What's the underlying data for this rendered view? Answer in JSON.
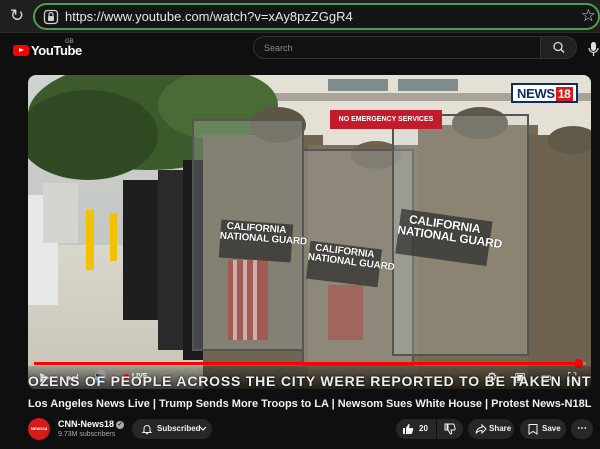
{
  "browser": {
    "url": "https://www.youtube.com/watch?v=xAy8pzZGgR4"
  },
  "header": {
    "logo_text": "YouTube",
    "region": "GB",
    "search_placeholder": "Search"
  },
  "video": {
    "overlay_logo": "NEWS",
    "overlay_logo_num": "18",
    "scene_sign": "NO EMERGENCY SERVICES",
    "shield_text_1": "CALIFORNIA\nNATIONAL GUARD",
    "shield_text_2": "CALIFORNIA\nNATIONAL GUARD",
    "shield_text_3": "CALIFORNIA\nNATIONAL GUARD",
    "ticker": "OZENS OF PEOPLE ACROSS THE CITY WERE REPORTED TO BE TAKEN INTO CUSTODY B",
    "live_label": "LIVE",
    "progress_fraction": 0.985
  },
  "info": {
    "title": "Los Angeles News Live | Trump Sends More Troops to LA | Newsom Sues White House | Protest News-N18L",
    "channel_name": "CNN-News18",
    "avatar_text": "NEWS18",
    "subscribers": "9.73M subscribers",
    "subscribe_label": "Subscribed",
    "likes": "20",
    "share_label": "Share",
    "save_label": "Save"
  },
  "colors": {
    "accent": "#ff0000",
    "url_border": "#4f9d4f",
    "background": "#0f0f0f"
  }
}
